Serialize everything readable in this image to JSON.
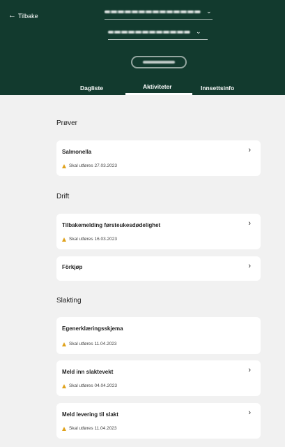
{
  "header": {
    "back_label": "Tilbake",
    "back_icon": "arrow-left-icon",
    "selector_icon": "chevron-down-icon",
    "tabs": [
      {
        "label": "Dagliste"
      },
      {
        "label": "Aktiviteter",
        "active": true
      },
      {
        "label": "Innsettsinfo"
      }
    ]
  },
  "colors": {
    "header_bg": "#123a2e",
    "page_bg": "#f1f1f1",
    "warning": "#e0a21b"
  },
  "sections": [
    {
      "title": "Prøver",
      "cards": [
        {
          "title": "Salmonella",
          "due": "Skal utføres 27.03.2023",
          "has_chevron": true
        }
      ]
    },
    {
      "title": "Drift",
      "cards": [
        {
          "title": "Tilbakemelding førsteukesdødelighet",
          "due": "Skal utføres 16.03.2023",
          "has_chevron": true
        },
        {
          "title": "Förkjøp",
          "due": "",
          "has_chevron": true
        }
      ]
    },
    {
      "title": "Slakting",
      "cards": [
        {
          "title": "Egenerklæringsskjema",
          "due": "Skal utføres 11.04.2023",
          "has_chevron": false
        },
        {
          "title": "Meld inn slaktevekt",
          "due": "Skal utføres 04.04.2023",
          "has_chevron": true
        },
        {
          "title": "Meld levering til slakt",
          "due": "Skal utføres 11.04.2023",
          "has_chevron": true
        }
      ]
    }
  ]
}
